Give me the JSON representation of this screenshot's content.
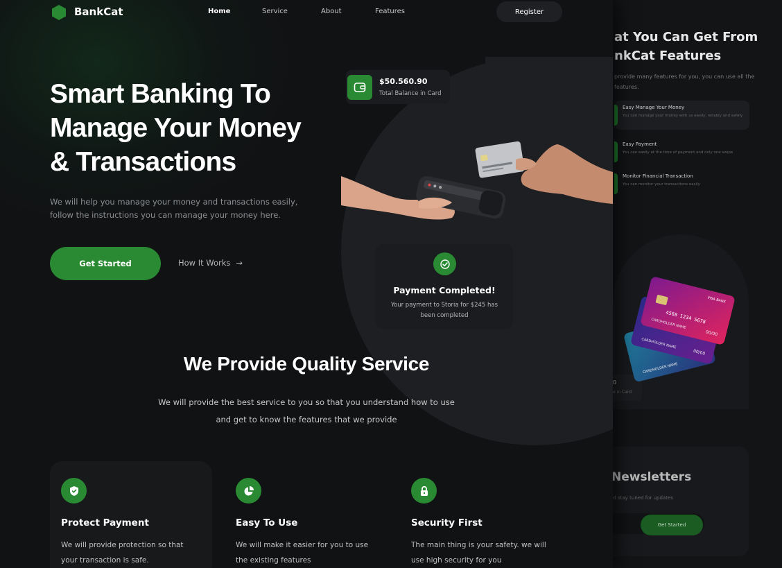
{
  "back": {
    "title": "at You Can Get From\nnkCat Features",
    "description": "provide many features for you, you can use all the features.",
    "features": [
      {
        "title": "Easy Manage Your Money",
        "text": "You can manage your money with us easily, reliably and safely"
      },
      {
        "title": "Easy Payment",
        "text": "You can easily at the time of payment and only one swipe"
      },
      {
        "title": "Monitor Financial Transaction",
        "text": "You can monitor your transactions easily"
      }
    ],
    "balance_partial_amount": "0",
    "balance_partial_label": "e in Card",
    "card_holder": "CARDHOLDER NAME",
    "card_brand": "VISA BANK",
    "card_number": "4568 1234 5678",
    "card_expiry": "00/00",
    "newsletter": {
      "title": "Newsletters",
      "subtitle": "nd stay tuned for updates",
      "button": "Get Started"
    }
  },
  "nav": {
    "logo": "BankCat",
    "links": [
      "Home",
      "Service",
      "About",
      "Features"
    ],
    "register": "Register"
  },
  "hero": {
    "title": "Smart Banking To\nManage Your Money\n& Transactions",
    "description": "We will help you manage your money and transactions easily, follow the instructions you can manage your money here.",
    "primary_cta": "Get Started",
    "secondary_cta": "How It Works",
    "secondary_cta_arrow": "→"
  },
  "balance_card": {
    "amount": "$50.560.90",
    "label": "Total Balance in Card"
  },
  "payment_card": {
    "title": "Payment Completed!",
    "text": "Your payment to Storia for $245 has been completed"
  },
  "services": {
    "title": "We Provide Quality Service",
    "description": "We will provide the best service to you so that you understand how to use and get to know the features that we provide",
    "items": [
      {
        "title": "Protect Payment",
        "text": "We will provide protection so that your transaction is safe."
      },
      {
        "title": "Easy To Use",
        "text": "We will make it easier for you to use the existing features"
      },
      {
        "title": "Security First",
        "text": "The main thing is your safety. we will use high security for you"
      }
    ]
  },
  "colors": {
    "accent": "#2a8a33",
    "background": "#111214",
    "card": "#1a1c1f"
  },
  "icons": [
    "hexagon-logo-icon",
    "wallet-icon",
    "check-icon",
    "shield-icon",
    "pie-chart-icon",
    "lock-icon",
    "arrow-right-icon"
  ]
}
